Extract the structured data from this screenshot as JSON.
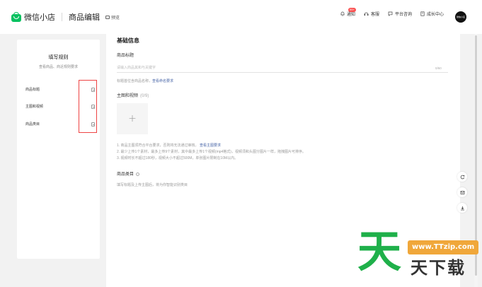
{
  "header": {
    "brand": "微信小店",
    "page_title": "商品编辑",
    "preview_label": "预览",
    "actions": [
      {
        "label": "通知",
        "badge": "99+",
        "icon": "bell-icon"
      },
      {
        "label": "客服",
        "icon": "headset-icon"
      },
      {
        "label": "平台咨询",
        "icon": "chat-icon"
      },
      {
        "label": "成长中心",
        "icon": "book-icon"
      }
    ],
    "avatar_text": "微信小店"
  },
  "sidebar": {
    "title": "填写规则",
    "subtitle": "查看商品、商近规则要求",
    "items": [
      {
        "label": "商品标题",
        "icon": "doc-icon"
      },
      {
        "label": "主图和视频",
        "icon": "doc-icon"
      },
      {
        "label": "商品类目",
        "icon": "doc-icon"
      }
    ]
  },
  "main": {
    "section_title": "基础信息",
    "title_field": {
      "label": "商品标题",
      "placeholder": "请输入商品其和与关键字",
      "counter": "0/60",
      "hint": "标题首位含商品名称，",
      "hint_link": "查看命名要求"
    },
    "media_field": {
      "label": "主图和视频",
      "count": "(0/9)",
      "plus": "+",
      "notes": [
        "1. 商品主图须符合平台要求，否则将无法通过审核。",
        "2. 最少上传1个素材，最多上传9个素材，其中最多上传1个视频(mp4格式)，视频须和头图分图片一样，拖拽图片可排序。",
        "3. 视频时长不超过180秒，视频大小不超过500M，单张图片限制在10M以内。"
      ],
      "notes_link": "查看主图要求"
    },
    "category_field": {
      "label": "商品类目",
      "hint": "填写标题及上传主图后，将为你智能识别类目"
    }
  },
  "float_tools": [
    {
      "icon": "refresh-icon"
    },
    {
      "icon": "mail-icon"
    },
    {
      "icon": "download-icon"
    }
  ],
  "watermark": {
    "big": "天",
    "url": "www.TTzip.com",
    "small": "天下载"
  },
  "colors": {
    "brand_green": "#07c160",
    "highlight_red": "#e44444",
    "link_blue": "#4a67a8"
  }
}
